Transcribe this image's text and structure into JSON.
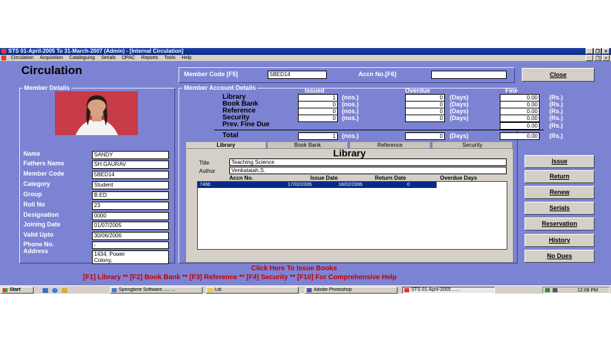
{
  "window": {
    "title": "STS   01-April-2005   To  31-March-2007    (Admin) - [Internal Circulation]",
    "min": "_",
    "restore": "❐",
    "close": "×"
  },
  "menu": [
    "Circulation",
    "Acquisition",
    "Cataloguing",
    "Serials",
    "OPAC",
    "Reports",
    "Tools",
    "Help"
  ],
  "form": {
    "heading": "Circulation",
    "member_code_label": "Member Code [F5]",
    "member_code_value": "5BED14",
    "accn_label": "Accn No.[F6]",
    "accn_value": "",
    "close_label": "Close",
    "member_details_label": "Member Details",
    "account_details_label": "Member Account Details"
  },
  "member": {
    "fields": [
      {
        "label": "Name",
        "value": "SANDY"
      },
      {
        "label": "Fathers Name",
        "value": "SH.GAURAV"
      },
      {
        "label": "Member Code",
        "value": "5BED14"
      },
      {
        "label": "Category",
        "value": "Student"
      },
      {
        "label": "Group",
        "value": "B.ED"
      },
      {
        "label": "Roll No",
        "value": "23"
      },
      {
        "label": "Designation",
        "value": "0000"
      },
      {
        "label": "Joining Date",
        "value": "01/07/2005"
      },
      {
        "label": "Valid Upto",
        "value": "30/06/2006"
      },
      {
        "label": "Phone No.",
        "value": "-"
      }
    ],
    "address_label": "Address",
    "address_line1": "1434, Power",
    "address_line2": "Colony,"
  },
  "account": {
    "headers": {
      "issued": "Issued",
      "overdue": "Overdue",
      "fine": "Fine"
    },
    "units": {
      "nos": "(nos.)",
      "days": "(Days)",
      "rs": "(Rs.)"
    },
    "rows": [
      {
        "label": "Library",
        "issued": "1",
        "overdue": "0",
        "fine": "0.00"
      },
      {
        "label": "Book Bank",
        "issued": "0",
        "overdue": "0",
        "fine": "0.00"
      },
      {
        "label": "Reference",
        "issued": "0",
        "overdue": "0",
        "fine": "0.00"
      },
      {
        "label": "Security",
        "issued": "0",
        "overdue": "0",
        "fine": "0.00"
      }
    ],
    "prev_fine_label": "Prev. Fine Due",
    "prev_fine_value": "0.00",
    "total_label": "Total",
    "total_issued": "1",
    "total_overdue": "0",
    "total_fine": "0.00"
  },
  "tabs": [
    "Library",
    "Book Bank",
    "Reference",
    "Security"
  ],
  "library": {
    "heading": "Library",
    "title_label": "Title",
    "title_value": "Teaching Science",
    "author_label": "Author",
    "author_value": "Venkataiah,S.",
    "columns": [
      "Accn No.",
      "Issue Date",
      "Return Date",
      "Overdue Days"
    ],
    "rows": [
      {
        "accn": "7490",
        "issue": "17/02/2006",
        "return": "18/02/2006",
        "overdue": "0"
      }
    ]
  },
  "actions": [
    "Issue",
    "Return",
    "Renew",
    "Serials",
    "Reservation",
    "History",
    "No Dues"
  ],
  "footer": {
    "click_text": "Click Here To Issue Books",
    "hotkeys": "[F1] Library ** [F2] Book Bank ** [F3] Reference ** [F4] Security ** [F10] For Comprehensive Help"
  },
  "taskbar": {
    "start": "Start",
    "tasks": [
      "Springtime Software...... ...",
      "Lib",
      "Adobe Photoshop",
      "STS   01-April-2005  ......"
    ],
    "clock": "12:08 PM"
  },
  "colors": {
    "app_bg": "#7d83d3",
    "title_bar": "#0a2a85",
    "footer_red": "#c00000",
    "selection": "#0a2a85"
  }
}
